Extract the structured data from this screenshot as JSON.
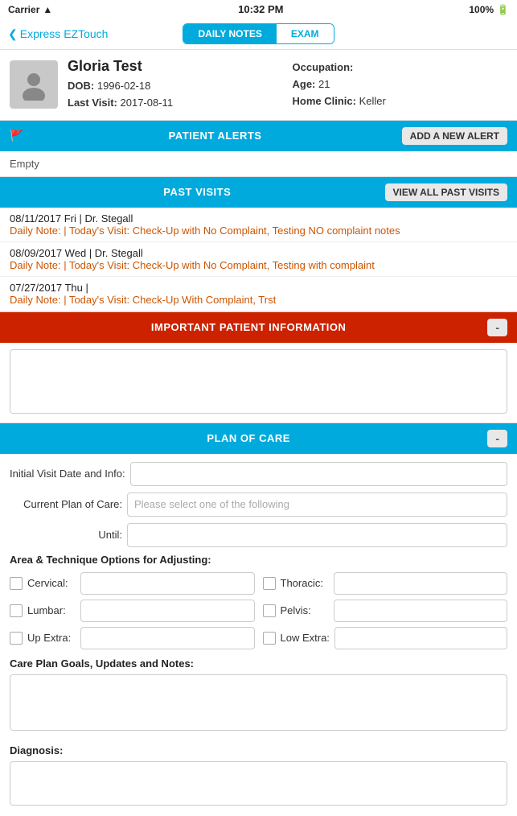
{
  "status_bar": {
    "carrier": "Carrier",
    "wifi_icon": "wifi-icon",
    "time": "10:32 PM",
    "battery": "100%",
    "battery_icon": "battery-icon"
  },
  "nav": {
    "back_label": "Express EZTouch",
    "tabs": [
      {
        "id": "daily_notes",
        "label": "DAILY NOTES",
        "active": true
      },
      {
        "id": "exam",
        "label": "EXAM",
        "active": false
      }
    ]
  },
  "patient": {
    "name": "Gloria Test",
    "dob_label": "DOB:",
    "dob_value": "1996-02-18",
    "last_visit_label": "Last Visit:",
    "last_visit_value": "2017-08-11",
    "occupation_label": "Occupation:",
    "occupation_value": "",
    "age_label": "Age:",
    "age_value": "21",
    "home_clinic_label": "Home Clinic:",
    "home_clinic_value": "Keller"
  },
  "patient_alerts": {
    "section_title": "PATIENT ALERTS",
    "flag_icon": "flag-icon",
    "add_btn": "ADD A NEW ALERT",
    "empty_text": "Empty"
  },
  "past_visits": {
    "section_title": "PAST VISITS",
    "view_all_btn": "VIEW ALL PAST VISITS",
    "visits": [
      {
        "date_line": "08/11/2017 Fri | Dr. Stegall",
        "note": "Daily Note: | Today's Visit: Check-Up with No Complaint, Testing NO complaint notes"
      },
      {
        "date_line": "08/09/2017 Wed | Dr. Stegall",
        "note": "Daily Note: | Today's Visit: Check-Up with No Complaint, Testing with complaint"
      },
      {
        "date_line": "07/27/2017 Thu |",
        "note": "Daily Note: | Today's Visit: Check-Up With Complaint, Trst"
      }
    ]
  },
  "important_info": {
    "section_title": "IMPORTANT PATIENT INFORMATION",
    "collapse_btn": "-",
    "content": ""
  },
  "plan_of_care": {
    "section_title": "PLAN OF CARE",
    "collapse_btn": "-",
    "initial_visit_label": "Initial Visit Date and Info:",
    "initial_visit_value": "",
    "current_plan_label": "Current Plan of Care:",
    "current_plan_placeholder": "Please select one of the following",
    "current_plan_value": "",
    "until_label": "Until:",
    "until_value": "",
    "area_title": "Area & Technique Options for Adjusting:",
    "adjust_options": [
      {
        "id": "cervical",
        "label": "Cervical:",
        "value": ""
      },
      {
        "id": "thoracic",
        "label": "Thoracic:",
        "value": ""
      },
      {
        "id": "lumbar",
        "label": "Lumbar:",
        "value": ""
      },
      {
        "id": "pelvis",
        "label": "Pelvis:",
        "value": ""
      },
      {
        "id": "up_extra",
        "label": "Up Extra:",
        "value": ""
      },
      {
        "id": "low_extra",
        "label": "Low Extra:",
        "value": ""
      }
    ],
    "care_goals_title": "Care Plan Goals, Updates and Notes:",
    "care_goals_value": "",
    "diagnosis_title": "Diagnosis:",
    "diagnosis_value": ""
  }
}
